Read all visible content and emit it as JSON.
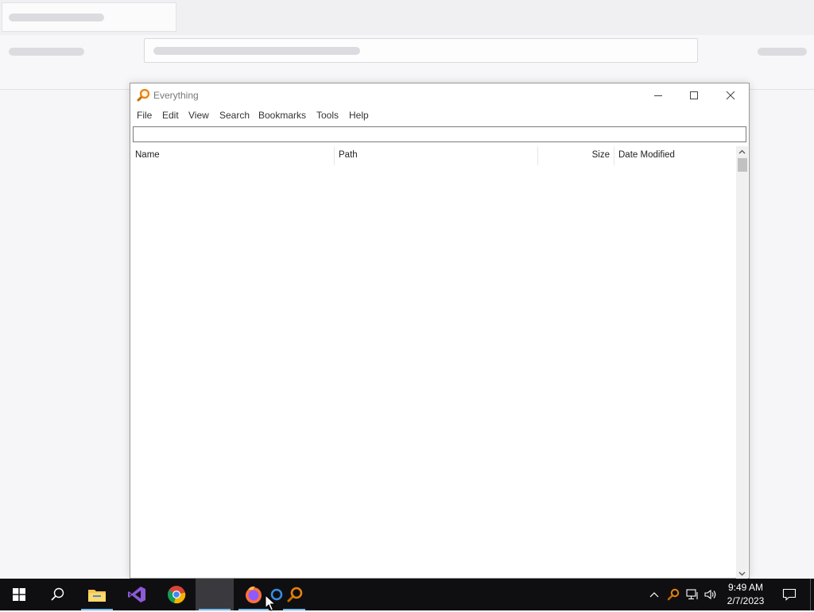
{
  "window": {
    "title": "Everything",
    "icon": "magnifier-icon",
    "controls": [
      "minimize-icon",
      "maximize-icon",
      "close-icon"
    ]
  },
  "menu": {
    "file": "File",
    "edit": "Edit",
    "view": "View",
    "search": "Search",
    "bookmarks": "Bookmarks",
    "tools": "Tools",
    "help": "Help"
  },
  "search": {
    "value": "",
    "placeholder": ""
  },
  "columns": {
    "name": "Name",
    "path": "Path",
    "size": "Size",
    "date_modified": "Date Modified"
  },
  "results": [],
  "taskbar": {
    "apps": [
      "start-icon",
      "search-icon",
      "file-explorer-icon",
      "visual-studio-icon",
      "chrome-icon",
      "blank-window",
      "firefox-icon",
      "app-circle-icon",
      "everything-icon"
    ],
    "tray": [
      "chevron-up-icon",
      "everything-tray-icon",
      "network-icon",
      "volume-icon"
    ],
    "time": "9:49 AM",
    "date": "2/7/2023"
  },
  "colors": {
    "taskbar": "#0f0f12",
    "accent": "#76b9ed",
    "everything_orange": "#e8820c"
  }
}
